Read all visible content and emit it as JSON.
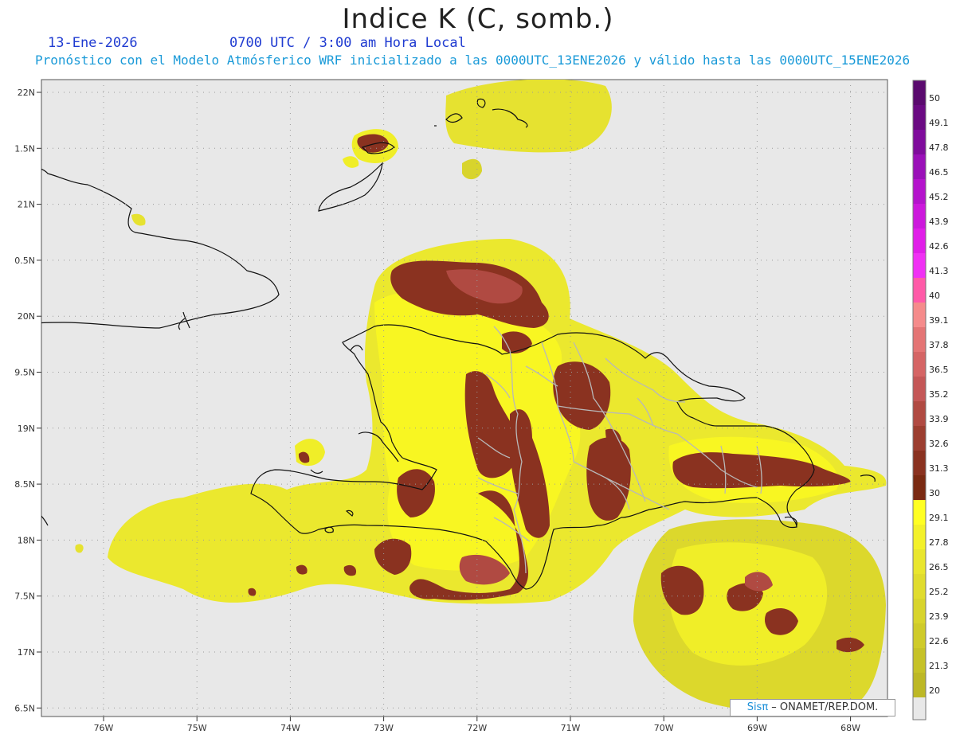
{
  "header": {
    "title": "Indice K (C, somb.)",
    "date": "13-Ene-2026",
    "time": "0700 UTC / 3:00 am Hora Local",
    "description": "Pronóstico con el Modelo Atmósferico WRF inicializado a las 0000UTC_13ENE2026 y válido hasta las  0000UTC_15ENE2026"
  },
  "map": {
    "lat_ticks": [
      "22N",
      "1.5N",
      "21N",
      "0.5N",
      "20N",
      "9.5N",
      "19N",
      "8.5N",
      "18N",
      "7.5N",
      "17N",
      "6.5N"
    ],
    "lon_ticks": [
      "76W",
      "75W",
      "74W",
      "73W",
      "72W",
      "71W",
      "70W",
      "69W",
      "68W"
    ],
    "ocean_color": "#e8e8e8"
  },
  "colorbar": {
    "levels": [
      {
        "label": "50",
        "color": "#5a0a6e"
      },
      {
        "label": "49.1",
        "color": "#6a0a82"
      },
      {
        "label": "47.8",
        "color": "#7f0c9c"
      },
      {
        "label": "46.5",
        "color": "#9a10b8"
      },
      {
        "label": "45.2",
        "color": "#b413cc"
      },
      {
        "label": "43.9",
        "color": "#cc18dc"
      },
      {
        "label": "42.6",
        "color": "#e01ee8"
      },
      {
        "label": "41.3",
        "color": "#f030f4"
      },
      {
        "label": "40",
        "color": "#ff5aa8"
      },
      {
        "label": "39.1",
        "color": "#f58b8b"
      },
      {
        "label": "37.8",
        "color": "#e47575"
      },
      {
        "label": "36.5",
        "color": "#d56565"
      },
      {
        "label": "35.2",
        "color": "#c45757"
      },
      {
        "label": "33.9",
        "color": "#b04a42"
      },
      {
        "label": "32.6",
        "color": "#9c3e30"
      },
      {
        "label": "31.3",
        "color": "#8a3220"
      },
      {
        "label": "30",
        "color": "#7a2a12"
      },
      {
        "label": "29.1",
        "color": "#ffff22"
      },
      {
        "label": "27.8",
        "color": "#f3f12a"
      },
      {
        "label": "26.5",
        "color": "#e9e62e"
      },
      {
        "label": "25.2",
        "color": "#e0dc2e"
      },
      {
        "label": "23.9",
        "color": "#d8d42c"
      },
      {
        "label": "22.6",
        "color": "#cfcb2a"
      },
      {
        "label": "21.3",
        "color": "#c6c228"
      },
      {
        "label": "20",
        "color": "#bdb826"
      }
    ],
    "bottom_color": "#e8e8e8"
  },
  "credit": {
    "brand": "Sisπ",
    "text": " – ONAMET/REP.DOM."
  }
}
